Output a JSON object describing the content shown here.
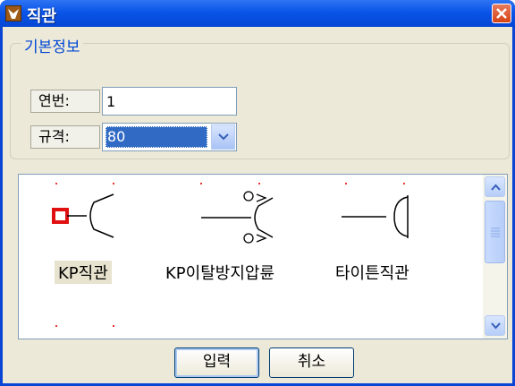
{
  "window": {
    "title": "직관"
  },
  "group": {
    "title": "기본정보",
    "serial_label": "연번:",
    "serial_value": "1",
    "spec_label": "규격:",
    "spec_value": "80"
  },
  "items": [
    {
      "label": "KP직관",
      "icon": "pipe-straight-icon",
      "selected": true
    },
    {
      "label": "KP이탈방지압륜",
      "icon": "pipe-ring-icon",
      "selected": false
    },
    {
      "label": "타이튼직관",
      "icon": "tyton-pipe-icon",
      "selected": false
    }
  ],
  "buttons": {
    "ok": "입력",
    "cancel": "취소"
  }
}
